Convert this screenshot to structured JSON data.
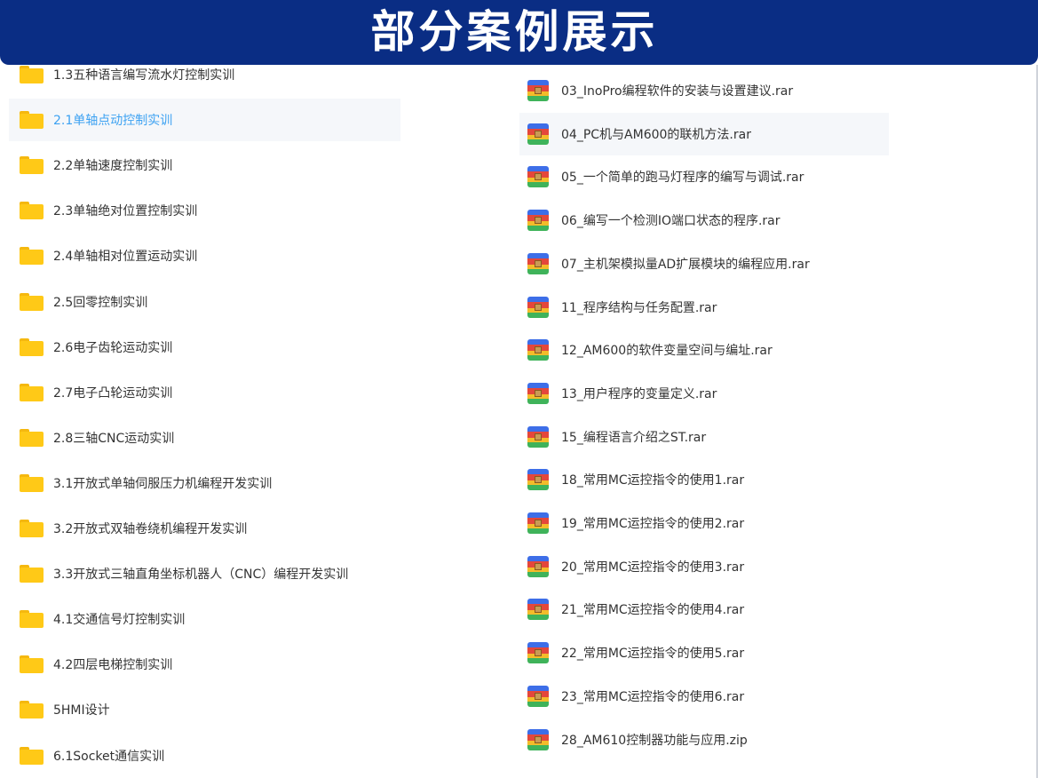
{
  "banner": {
    "title": "部分案例展示"
  },
  "colors": {
    "banner": "#0a2d84",
    "folder": "#ffc917",
    "selected_text": "#3da2f2",
    "text": "#333333"
  },
  "left_folders": [
    {
      "label": "1.3五种语言编写流水灯控制实训",
      "icon": "folder-icon"
    },
    {
      "label": "2.1单轴点动控制实训",
      "icon": "folder-icon",
      "selected": true
    },
    {
      "label": "2.2单轴速度控制实训",
      "icon": "folder-icon"
    },
    {
      "label": "2.3单轴绝对位置控制实训",
      "icon": "folder-icon"
    },
    {
      "label": "2.4单轴相对位置运动实训",
      "icon": "folder-icon"
    },
    {
      "label": "2.5回零控制实训",
      "icon": "folder-icon"
    },
    {
      "label": "2.6电子齿轮运动实训",
      "icon": "folder-icon"
    },
    {
      "label": "2.7电子凸轮运动实训",
      "icon": "folder-icon"
    },
    {
      "label": "2.8三轴CNC运动实训",
      "icon": "folder-icon"
    },
    {
      "label": "3.1开放式单轴伺服压力机编程开发实训",
      "icon": "folder-icon"
    },
    {
      "label": "3.2开放式双轴卷绕机编程开发实训",
      "icon": "folder-icon"
    },
    {
      "label": "3.3开放式三轴直角坐标机器人（CNC）编程开发实训",
      "icon": "folder-icon"
    },
    {
      "label": "4.1交通信号灯控制实训",
      "icon": "folder-icon"
    },
    {
      "label": "4.2四层电梯控制实训",
      "icon": "folder-icon"
    },
    {
      "label": "5HMI设计",
      "icon": "folder-icon"
    },
    {
      "label": "6.1Socket通信实训",
      "icon": "folder-icon"
    }
  ],
  "right_files": [
    {
      "label": "03_InoPro编程软件的安装与设置建议.rar",
      "icon": "archive-icon"
    },
    {
      "label": "04_PC机与AM600的联机方法.rar",
      "icon": "archive-icon",
      "selected": true
    },
    {
      "label": "05_一个简单的跑马灯程序的编写与调试.rar",
      "icon": "archive-icon"
    },
    {
      "label": "06_编写一个检测IO端口状态的程序.rar",
      "icon": "archive-icon"
    },
    {
      "label": "07_主机架模拟量AD扩展模块的编程应用.rar",
      "icon": "archive-icon"
    },
    {
      "label": "11_程序结构与任务配置.rar",
      "icon": "archive-icon"
    },
    {
      "label": "12_AM600的软件变量空间与编址.rar",
      "icon": "archive-icon"
    },
    {
      "label": "13_用户程序的变量定义.rar",
      "icon": "archive-icon"
    },
    {
      "label": "15_编程语言介绍之ST.rar",
      "icon": "archive-icon"
    },
    {
      "label": "18_常用MC运控指令的使用1.rar",
      "icon": "archive-icon"
    },
    {
      "label": "19_常用MC运控指令的使用2.rar",
      "icon": "archive-icon"
    },
    {
      "label": "20_常用MC运控指令的使用3.rar",
      "icon": "archive-icon"
    },
    {
      "label": "21_常用MC运控指令的使用4.rar",
      "icon": "archive-icon"
    },
    {
      "label": "22_常用MC运控指令的使用5.rar",
      "icon": "archive-icon"
    },
    {
      "label": "23_常用MC运控指令的使用6.rar",
      "icon": "archive-icon"
    },
    {
      "label": "28_AM610控制器功能与应用.zip",
      "icon": "archive-icon"
    }
  ]
}
